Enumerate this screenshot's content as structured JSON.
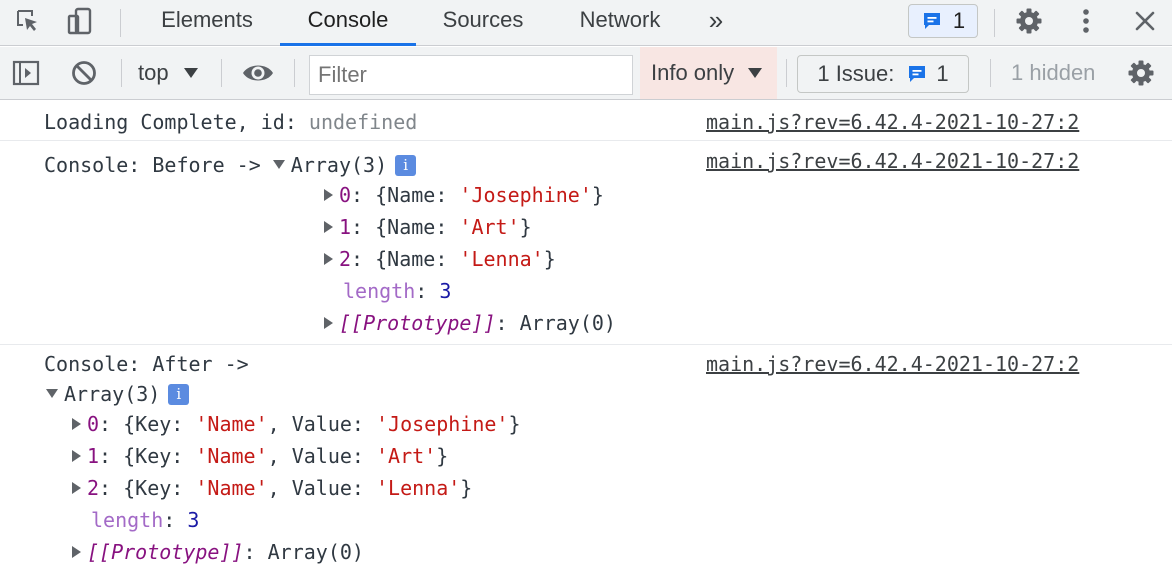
{
  "tabs": [
    {
      "label": "Elements"
    },
    {
      "label": "Console",
      "active": true
    },
    {
      "label": "Sources"
    },
    {
      "label": "Network"
    }
  ],
  "tabs_more": "»",
  "message_badge_count": "1",
  "toolbar": {
    "context": "top",
    "filter_placeholder": "Filter",
    "levels": "Info only",
    "issues_label": "1 Issue:",
    "issues_count": "1",
    "hidden": "1 hidden"
  },
  "messages": {
    "m1": {
      "text": "Loading Complete, id: ",
      "value": "undefined",
      "source": "main.js?rev=6.42.4-2021-10-27:2"
    },
    "m2": {
      "text": "Console: Before -> ",
      "summary": "Array(3)",
      "info": "i",
      "source": "main.js?rev=6.42.4-2021-10-27:2",
      "items": [
        {
          "index": "0",
          "name": "'Josephine'"
        },
        {
          "index": "1",
          "name": "'Art'"
        },
        {
          "index": "2",
          "name": "'Lenna'"
        }
      ],
      "length_key": "length",
      "length_value": "3",
      "proto_key": "[[Prototype]]",
      "proto_value": "Array(0)"
    },
    "m3": {
      "text": "Console: After ->",
      "summary": "Array(3)",
      "info": "i",
      "source": "main.js?rev=6.42.4-2021-10-27:2",
      "items": [
        {
          "index": "0",
          "key": "'Name'",
          "value": "'Josephine'"
        },
        {
          "index": "1",
          "key": "'Name'",
          "value": "'Art'"
        },
        {
          "index": "2",
          "key": "'Name'",
          "value": "'Lenna'"
        }
      ],
      "length_key": "length",
      "length_value": "3",
      "proto_key": "[[Prototype]]",
      "proto_value": "Array(0)"
    }
  },
  "colors": {
    "accent": "#1a73e8",
    "string": "#c41a16",
    "index": "#881280",
    "number": "#1a1aa6"
  }
}
